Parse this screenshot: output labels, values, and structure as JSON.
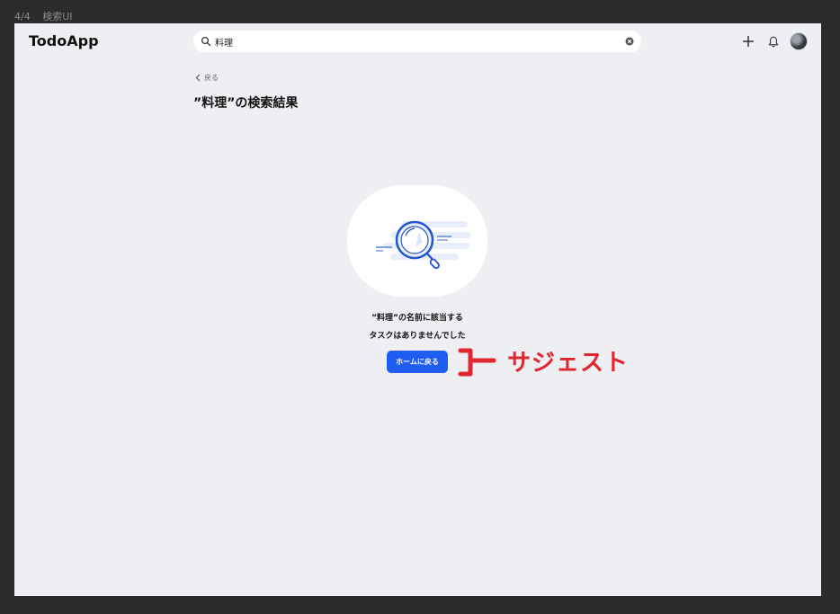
{
  "frame": {
    "counter": "4/4",
    "name": "検索UI"
  },
  "header": {
    "logo": "TodoApp",
    "search_value": "料理"
  },
  "icons": {
    "search": "search-icon",
    "clear": "clear-icon",
    "add": "plus-icon",
    "notifications": "bell-icon",
    "avatar": "avatar"
  },
  "main": {
    "back_label": "戻る",
    "title": "”料理”の検索結果",
    "empty_line1": "”料理”の名前に該当する",
    "empty_line2": "タスクはありませんでした",
    "home_button": "ホームに戻る"
  },
  "annotation": {
    "label": "サジェスト"
  },
  "colors": {
    "accent": "#1f5cf2",
    "annotation": "#e0262f",
    "background": "#eeeff3"
  }
}
